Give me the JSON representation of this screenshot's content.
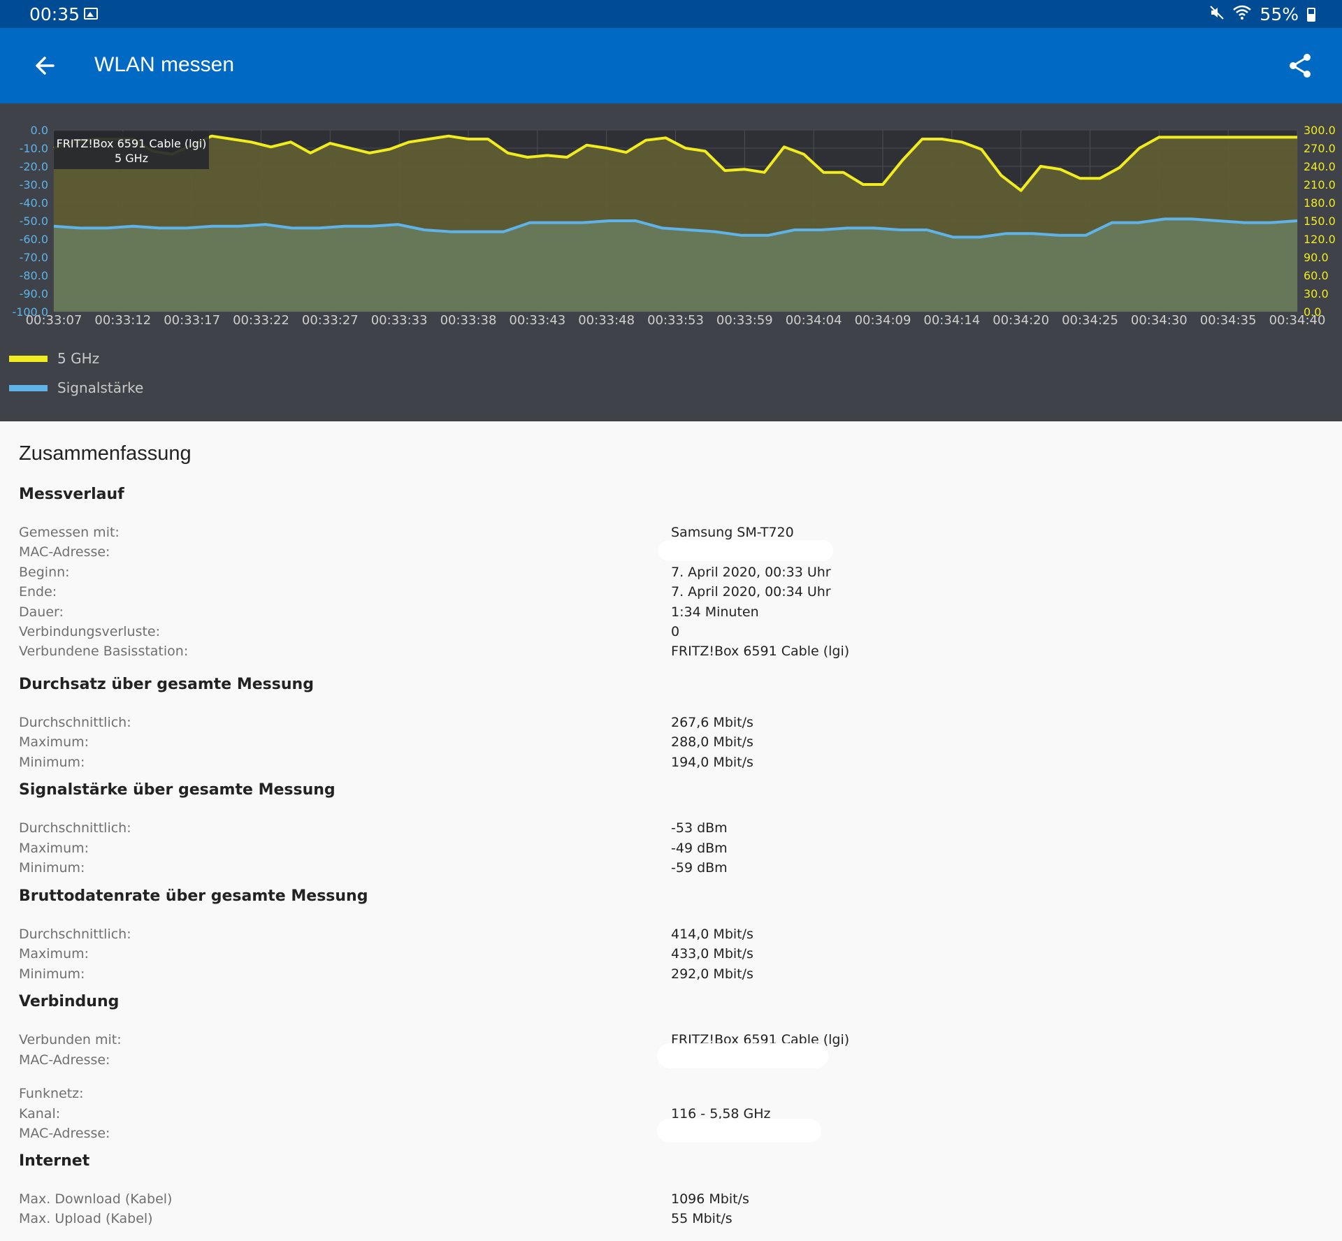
{
  "status_bar": {
    "time": "00:35",
    "battery": "55%"
  },
  "app_bar": {
    "title": "WLAN messen"
  },
  "chart_data": {
    "type": "line",
    "x": [
      "00:33:07",
      "00:33:12",
      "00:33:17",
      "00:33:22",
      "00:33:27",
      "00:33:33",
      "00:33:38",
      "00:33:43",
      "00:33:48",
      "00:33:53",
      "00:33:59",
      "00:34:04",
      "00:34:09",
      "00:34:14",
      "00:34:20",
      "00:34:25",
      "00:34:30",
      "00:34:35",
      "00:34:40"
    ],
    "y_left": {
      "ticks": [
        "0.0",
        "-10.0",
        "-20.0",
        "-30.0",
        "-40.0",
        "-50.0",
        "-60.0",
        "-70.0",
        "-80.0",
        "-90.0",
        "-100.0"
      ],
      "ylim": [
        -100,
        0
      ]
    },
    "y_right": {
      "ticks": [
        "300.0",
        "270.0",
        "240.0",
        "210.0",
        "180.0",
        "150.0",
        "120.0",
        "90.0",
        "60.0",
        "30.0",
        "0.0"
      ],
      "ylim": [
        0,
        300
      ]
    },
    "grid": true,
    "series": [
      {
        "name": "5 GHz",
        "color": "#f1ec1e",
        "axis": "right",
        "values": [
          270,
          280,
          285,
          285,
          285,
          265,
          260,
          275,
          290,
          285,
          280,
          272,
          280,
          262,
          278,
          270,
          262,
          268,
          280,
          285,
          290,
          285,
          285,
          262,
          255,
          258,
          255,
          275,
          270,
          263,
          283,
          287,
          270,
          265,
          233,
          235,
          230,
          272,
          260,
          230,
          230,
          210,
          210,
          250,
          285,
          285,
          280,
          268,
          225,
          200,
          240,
          235,
          220,
          220,
          238,
          270,
          288,
          288,
          288,
          288,
          288,
          288,
          288,
          288
        ]
      },
      {
        "name": "Signalstärke",
        "color": "#5fb3e8",
        "axis": "left",
        "values": [
          -53,
          -54,
          -54,
          -53,
          -54,
          -54,
          -53,
          -53,
          -52,
          -54,
          -54,
          -53,
          -53,
          -52,
          -55,
          -56,
          -56,
          -56,
          -51,
          -51,
          -51,
          -50,
          -50,
          -54,
          -55,
          -56,
          -58,
          -58,
          -55,
          -55,
          -54,
          -54,
          -55,
          -55,
          -59,
          -59,
          -57,
          -57,
          -58,
          -58,
          -51,
          -51,
          -49,
          -49,
          -50,
          -51,
          -51,
          -50
        ]
      }
    ],
    "tooltip": {
      "line1": "FRITZ!Box 6591 Cable (lgi)",
      "line2": "5 GHz"
    },
    "legend": [
      {
        "label": "5 GHz",
        "color": "#f1ec1e"
      },
      {
        "label": "Signalstärke",
        "color": "#5fb3e8"
      }
    ],
    "legend_position": "bottom-left"
  },
  "summary": {
    "title": "Zusammenfassung",
    "sections": [
      {
        "title": "Messverlauf",
        "rows": [
          {
            "label": "Gemessen mit:",
            "value": "Samsung SM-T720"
          },
          {
            "label": "MAC-Adresse:",
            "value": ""
          },
          {
            "label": "Beginn:",
            "value": "7. April 2020, 00:33 Uhr"
          },
          {
            "label": "Ende:",
            "value": "7. April 2020, 00:34 Uhr"
          },
          {
            "label": "Dauer:",
            "value": "1:34 Minuten"
          },
          {
            "label": "Verbindungsverluste:",
            "value": "0"
          },
          {
            "label": "Verbundene Basisstation:",
            "value": "FRITZ!Box 6591 Cable (lgi)"
          }
        ]
      },
      {
        "title": "Durchsatz über gesamte Messung",
        "rows": [
          {
            "label": "Durchschnittlich:",
            "value": "267,6 Mbit/s"
          },
          {
            "label": "Maximum:",
            "value": "288,0 Mbit/s"
          },
          {
            "label": "Minimum:",
            "value": "194,0 Mbit/s"
          }
        ]
      },
      {
        "title": "Signalstärke über gesamte Messung",
        "rows": [
          {
            "label": "Durchschnittlich:",
            "value": "-53 dBm"
          },
          {
            "label": "Maximum:",
            "value": "-49 dBm"
          },
          {
            "label": "Minimum:",
            "value": "-59 dBm"
          }
        ]
      },
      {
        "title": "Bruttodatenrate über gesamte Messung",
        "rows": [
          {
            "label": "Durchschnittlich:",
            "value": "414,0 Mbit/s"
          },
          {
            "label": "Maximum:",
            "value": "433,0 Mbit/s"
          },
          {
            "label": "Minimum:",
            "value": "292,0 Mbit/s"
          }
        ]
      },
      {
        "title": "Verbindung",
        "rows": [
          {
            "label": "Verbunden mit:",
            "value": "FRITZ!Box 6591 Cable (lgi)"
          },
          {
            "label": "MAC-Adresse:",
            "value": ""
          },
          {
            "label": "Funknetz:",
            "value": ""
          },
          {
            "label": "Kanal:",
            "value": "116 - 5,58 GHz"
          },
          {
            "label": "MAC-Adresse:",
            "value": ""
          }
        ]
      },
      {
        "title": "Internet",
        "rows": [
          {
            "label": "Max. Download (Kabel)",
            "value": "1096 Mbit/s"
          },
          {
            "label": "Max. Upload (Kabel)",
            "value": "55 Mbit/s"
          }
        ]
      }
    ]
  }
}
